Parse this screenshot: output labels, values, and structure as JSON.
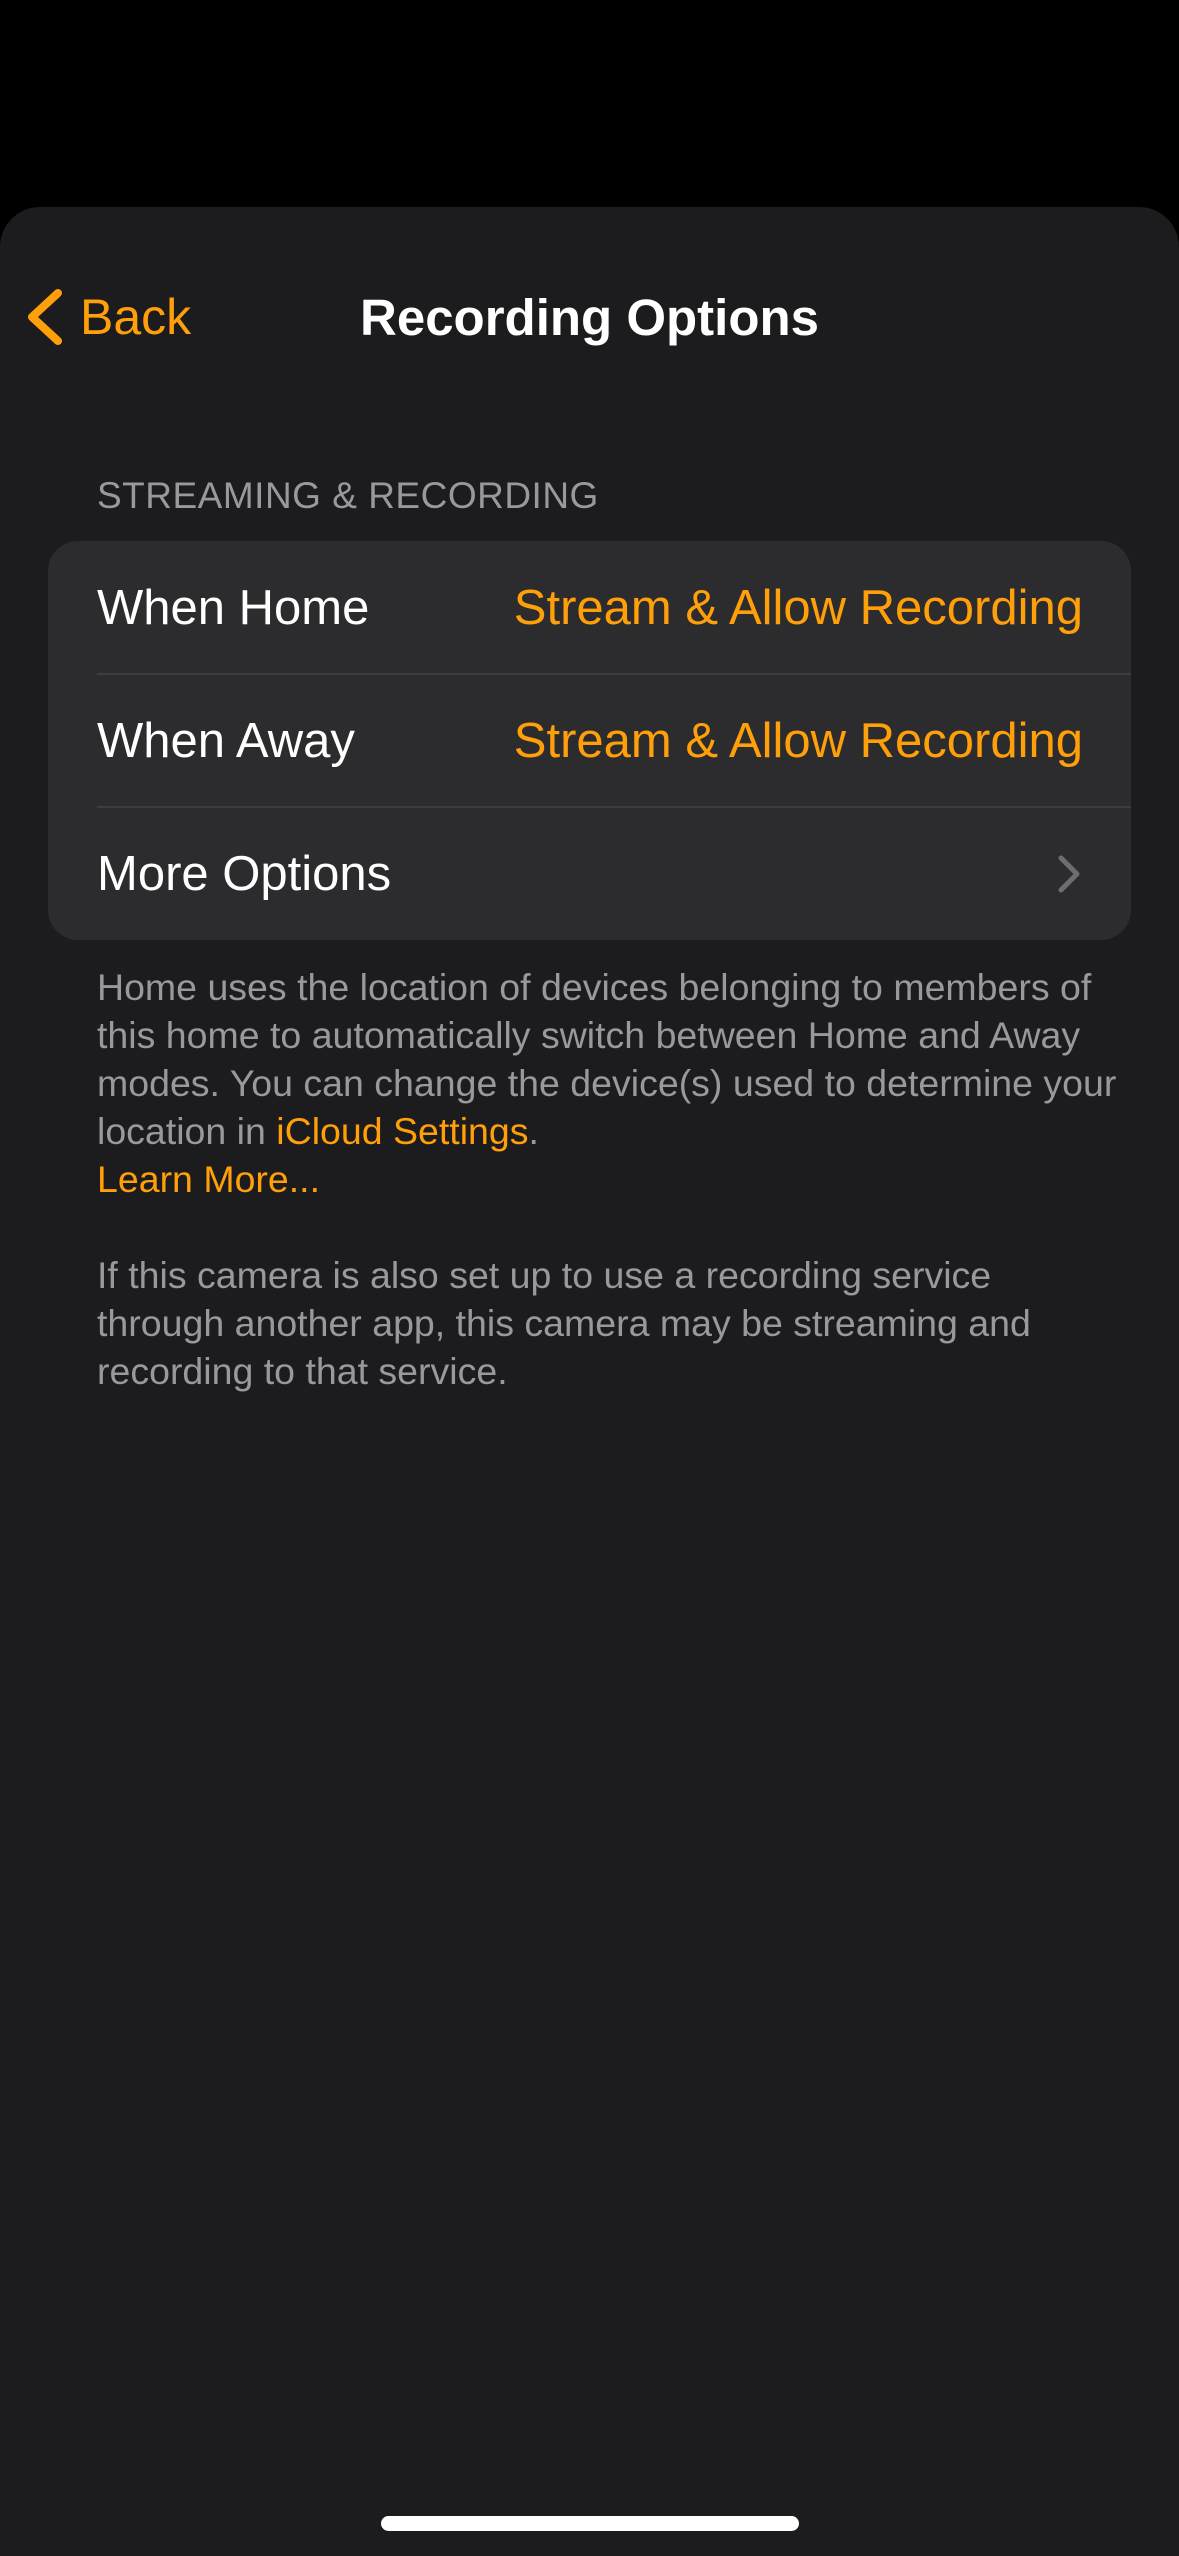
{
  "nav": {
    "back_label": "Back",
    "title": "Recording Options"
  },
  "section": {
    "header": "STREAMING & RECORDING",
    "rows": [
      {
        "label": "When Home",
        "value": "Stream & Allow Recording"
      },
      {
        "label": "When Away",
        "value": "Stream & Allow Recording"
      },
      {
        "label": "More Options",
        "value": ""
      }
    ]
  },
  "footer": {
    "location_text": "Home uses the location of devices belonging to members of this home to automatically switch between Home and Away modes. You can change the device(s) used to determine your location in ",
    "icloud_link": "iCloud Settings",
    "period": ".",
    "learn_more": "Learn More...",
    "service_note": "If this camera is also set up to use a recording service through another app, this camera may be streaming and recording to that service."
  },
  "icons": {
    "back": "chevron-left-icon",
    "disclosure": "chevron-right-icon"
  },
  "colors": {
    "accent": "#ff9f0a",
    "background": "#1c1c1e",
    "cell": "#2c2c2e",
    "secondary_text": "#98989f"
  }
}
